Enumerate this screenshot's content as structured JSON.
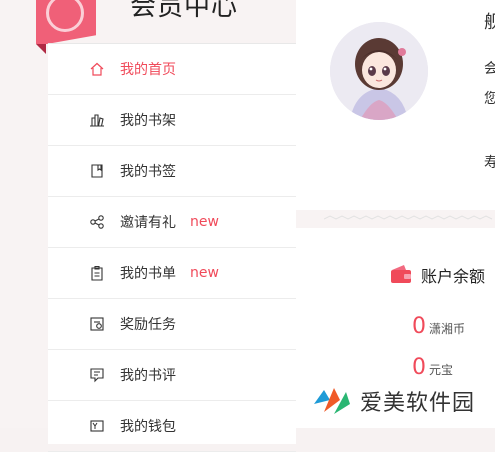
{
  "header": {
    "title": "会员中心"
  },
  "sidebar": {
    "items": [
      {
        "label": "我的首页",
        "icon": "home-icon",
        "tag": ""
      },
      {
        "label": "我的书架",
        "icon": "bookshelf-icon",
        "tag": ""
      },
      {
        "label": "我的书签",
        "icon": "bookmark-icon",
        "tag": ""
      },
      {
        "label": "邀请有礼",
        "icon": "share-icon",
        "tag": "new"
      },
      {
        "label": "我的书单",
        "icon": "booklist-icon",
        "tag": "new"
      },
      {
        "label": "奖励任务",
        "icon": "task-icon",
        "tag": ""
      },
      {
        "label": "我的书评",
        "icon": "review-icon",
        "tag": ""
      },
      {
        "label": "我的钱包",
        "icon": "wallet-icon",
        "tag": ""
      }
    ]
  },
  "profile": {
    "name_fragment": "舰",
    "line1_fragment": "会",
    "line2_fragment": "您",
    "line3_fragment": "寿"
  },
  "account": {
    "title": "账户余额",
    "balances": [
      {
        "value": "0",
        "unit": "潇湘币"
      },
      {
        "value": "0",
        "unit": "元宝"
      }
    ]
  },
  "watermark": {
    "text": "爱美软件园"
  },
  "colors": {
    "accent": "#f04a5a",
    "badge": "#f06078"
  }
}
